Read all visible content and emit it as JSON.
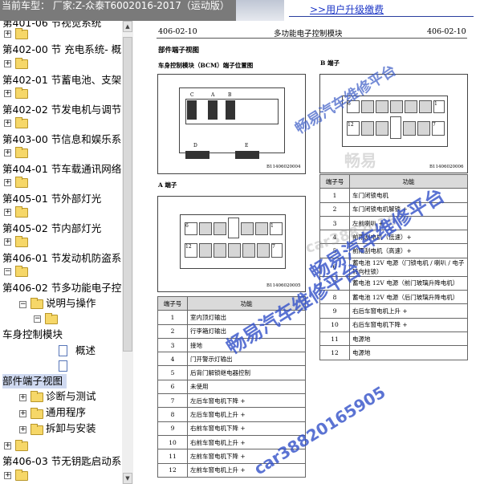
{
  "header": {
    "current_vehicle_text": "当前车型： 厂家:Z-众泰T6002016-2017（运动版）",
    "upgrade_link": ">>用户升级缴费"
  },
  "sidebar": {
    "items": [
      {
        "label": "第401-06 节视觉系统"
      },
      {
        "label": "第402-00 节 充电系统- 概"
      },
      {
        "label": "第402-01 节蓄电池、支架"
      },
      {
        "label": "第402-02 节发电机与调节"
      },
      {
        "label": "第403-00 节信息和娱乐系"
      },
      {
        "label": "第404-01 节车载通讯网络"
      },
      {
        "label": "第405-01 节外部灯光"
      },
      {
        "label": "第405-02 节内部灯光"
      },
      {
        "label": "第406-01 节发动机防盗系"
      },
      {
        "label": "第406-02 节多功能电子控"
      },
      {
        "label": "说明与操作"
      },
      {
        "label": "车身控制模块"
      },
      {
        "label": "概述"
      },
      {
        "label": "部件端子视图"
      },
      {
        "label": "诊断与测试"
      },
      {
        "label": "通用程序"
      },
      {
        "label": "拆卸与安装"
      },
      {
        "label": "第406-03 节无钥匙启动系"
      }
    ]
  },
  "document": {
    "page_left": "406-02-10",
    "page_title": "多功能电子控制模块",
    "page_right": "406-02-10",
    "section_title": "部件端子视图",
    "bcm_caption": "车身控制模块（BCM）端子位置图",
    "bcm_letters": [
      "C",
      "A",
      "B",
      "D",
      "E"
    ],
    "bcm_figure_id": "B11406020004",
    "connector_a_label": "A 端子",
    "connector_a_figure_id": "B11406020005",
    "connector_a_pins": [
      "6",
      "1",
      "12",
      "7"
    ],
    "connector_b_label": "B 端子",
    "connector_b_figure_id": "B11406020006",
    "connector_b_pins": [
      "6",
      "1",
      "12",
      "7"
    ],
    "table_a": {
      "headers": [
        "端子号",
        "功能"
      ],
      "rows": [
        [
          "1",
          "室内顶灯输出"
        ],
        [
          "2",
          "行李箱灯输出"
        ],
        [
          "3",
          "接地"
        ],
        [
          "4",
          "门开警示灯输出"
        ],
        [
          "5",
          "后背门解锁继电器控制"
        ],
        [
          "6",
          "未使用"
        ],
        [
          "7",
          "左后车窗电机下降 +"
        ],
        [
          "8",
          "左后车窗电机上升 +"
        ],
        [
          "9",
          "右前车窗电机下降 +"
        ],
        [
          "10",
          "右前车窗电机上升 +"
        ],
        [
          "11",
          "左前车窗电机下降 +"
        ],
        [
          "12",
          "左前车窗电机上升 +"
        ]
      ]
    },
    "table_b": {
      "headers": [
        "端子号",
        "功能"
      ],
      "rows": [
        [
          "1",
          "车门闭锁电机"
        ],
        [
          "2",
          "车门闭锁电机解锁 +"
        ],
        [
          "3",
          "左前喇叭 +"
        ],
        [
          "4",
          "前雨刮电机（低速）+"
        ],
        [
          "5",
          "前雨刮电机（高速）+"
        ],
        [
          "6",
          "蓄电池 12V 电源（门锁电机 / 喇叭 / 电子转向柱锁）"
        ],
        [
          "7",
          "蓄电池 12V 电源（前门玻璃升降电机）"
        ],
        [
          "8",
          "蓄电池 12V 电源（后门玻璃升降电机）"
        ],
        [
          "9",
          "右后车窗电机上升 +"
        ],
        [
          "10",
          "右后车窗电机下降 +"
        ],
        [
          "11",
          "电源地"
        ],
        [
          "12",
          "电源地"
        ]
      ]
    },
    "watermarks": [
      "畅易汽车维修平台",
      "畅易",
      "car38820165",
      "畅易汽车维修平台",
      "畅易汽车维修平台",
      "car38820165905"
    ]
  }
}
